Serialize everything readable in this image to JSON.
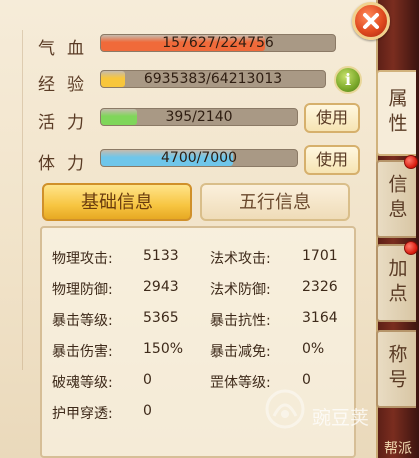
{
  "stats_bars": [
    {
      "label": "气血",
      "value_text": "157627/224756",
      "fraction": 0.701,
      "color": "#f06a3a"
    },
    {
      "label": "经验",
      "value_text": "6935383/64213013",
      "fraction": 0.108,
      "color": "#f8c63c"
    },
    {
      "label": "活力",
      "value_text": "395/2140",
      "fraction": 0.185,
      "color": "#7fd65a"
    },
    {
      "label": "体力",
      "value_text": "4700/7000",
      "fraction": 0.671,
      "color": "#6fc6ea"
    }
  ],
  "use_button_label": "使用",
  "info_icon_text": "i",
  "tabs": {
    "basic": "基础信息",
    "five_elements": "五行信息"
  },
  "attributes": [
    {
      "left_label": "物理攻击:",
      "left_value": "5133",
      "right_label": "法术攻击:",
      "right_value": "1701"
    },
    {
      "left_label": "物理防御:",
      "left_value": "2943",
      "right_label": "法术防御:",
      "right_value": "2326"
    },
    {
      "left_label": "暴击等级:",
      "left_value": "5365",
      "right_label": "暴击抗性:",
      "right_value": "3164"
    },
    {
      "left_label": "暴击伤害:",
      "left_value": "150%",
      "right_label": "暴击减免:",
      "right_value": "0%"
    },
    {
      "left_label": "破魂等级:",
      "left_value": "0",
      "right_label": "罡体等级:",
      "right_value": "0"
    },
    {
      "left_label": "护甲穿透:",
      "left_value": "0",
      "right_label": "",
      "right_value": ""
    }
  ],
  "side_tabs": [
    "属性",
    "信息",
    "加点",
    "称号"
  ],
  "watermark_text": "豌豆荚",
  "corner_text": "帮派"
}
